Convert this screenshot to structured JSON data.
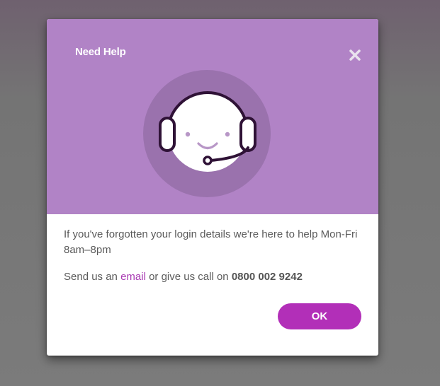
{
  "dialog": {
    "title": "Need Help",
    "close_icon": "close-icon",
    "illustration_icon": "support-agent-headset-icon",
    "help_text": "If you've forgotten your login details we're here to help Mon-Fri 8am–8pm",
    "contact_prefix": "Send us an ",
    "email_link": "email",
    "contact_middle": " or give us call on ",
    "phone_number": "0800 002 9242",
    "ok_label": "OK"
  },
  "colors": {
    "header_bg": "#b183c6",
    "illustration_circle": "#9a72ad",
    "accent": "#b22fb8",
    "link": "#a93bb3",
    "text": "#5a5a5a",
    "overlay": "#747474"
  }
}
